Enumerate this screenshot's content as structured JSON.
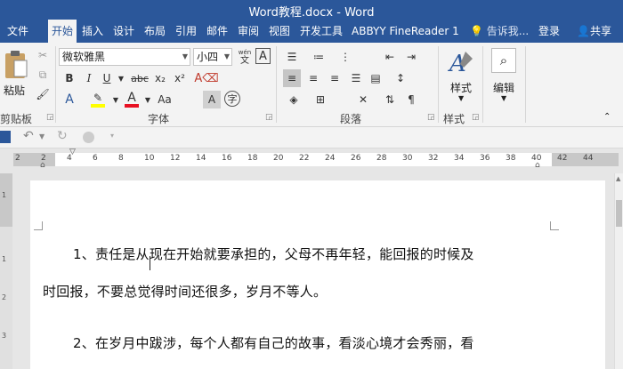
{
  "title_bar": {
    "title": "Word教程.docx - Word"
  },
  "tabs": [
    {
      "id": "file",
      "label": "文件"
    },
    {
      "id": "home",
      "label": "开始"
    },
    {
      "id": "insert",
      "label": "插入"
    },
    {
      "id": "design",
      "label": "设计"
    },
    {
      "id": "layout",
      "label": "布局"
    },
    {
      "id": "references",
      "label": "引用"
    },
    {
      "id": "mailings",
      "label": "邮件"
    },
    {
      "id": "review",
      "label": "审阅"
    },
    {
      "id": "view",
      "label": "视图"
    },
    {
      "id": "developer",
      "label": "开发工具"
    },
    {
      "id": "abbyy",
      "label": "ABBYY FineReader 1"
    }
  ],
  "tell_me": "告诉我...",
  "login_label": "登录",
  "share_label": "共享",
  "ribbon": {
    "clipboard": {
      "paste_label": "粘贴",
      "group_label": "剪贴板"
    },
    "font": {
      "font_name": "微软雅黑",
      "font_size": "小四",
      "wen_label": "wén",
      "group_label": "字体",
      "bold": "B",
      "italic": "I",
      "underline": "U",
      "strike": "abc",
      "subscript": "x₂",
      "superscript": "x²",
      "font_color_letter": "A",
      "case_label": "Aa",
      "grow_font": "A",
      "shrink_font": "A",
      "char_shade": "A",
      "enclose": "字"
    },
    "paragraph": {
      "group_label": "段落"
    },
    "styles": {
      "styles_label": "样式",
      "group_label": "样式"
    },
    "editing": {
      "editing_label": "编辑"
    }
  },
  "ruler": {
    "ticks": [
      "2",
      "2",
      "4",
      "6",
      "8",
      "10",
      "12",
      "14",
      "16",
      "18",
      "20",
      "22",
      "24",
      "26",
      "28",
      "30",
      "32",
      "34",
      "36",
      "38",
      "40",
      "42",
      "44"
    ]
  },
  "vertical_ruler": [
    "1",
    "1",
    "2",
    "3"
  ],
  "document": {
    "paragraphs": [
      "1、责任是从现在开始就要承担的，父母不再年轻，能回报的时候及",
      "时回报，不要总觉得时间还很多，岁月不等人。",
      "2、在岁月中跋涉，每个人都有自己的故事，看淡心境才会秀丽，看"
    ]
  },
  "colors": {
    "accent": "#2b579a",
    "ribbon_bg": "#f3f3f3",
    "workspace_bg": "#e6e6e6",
    "highlight_yellow": "#ffff00",
    "font_red": "#e81123"
  }
}
